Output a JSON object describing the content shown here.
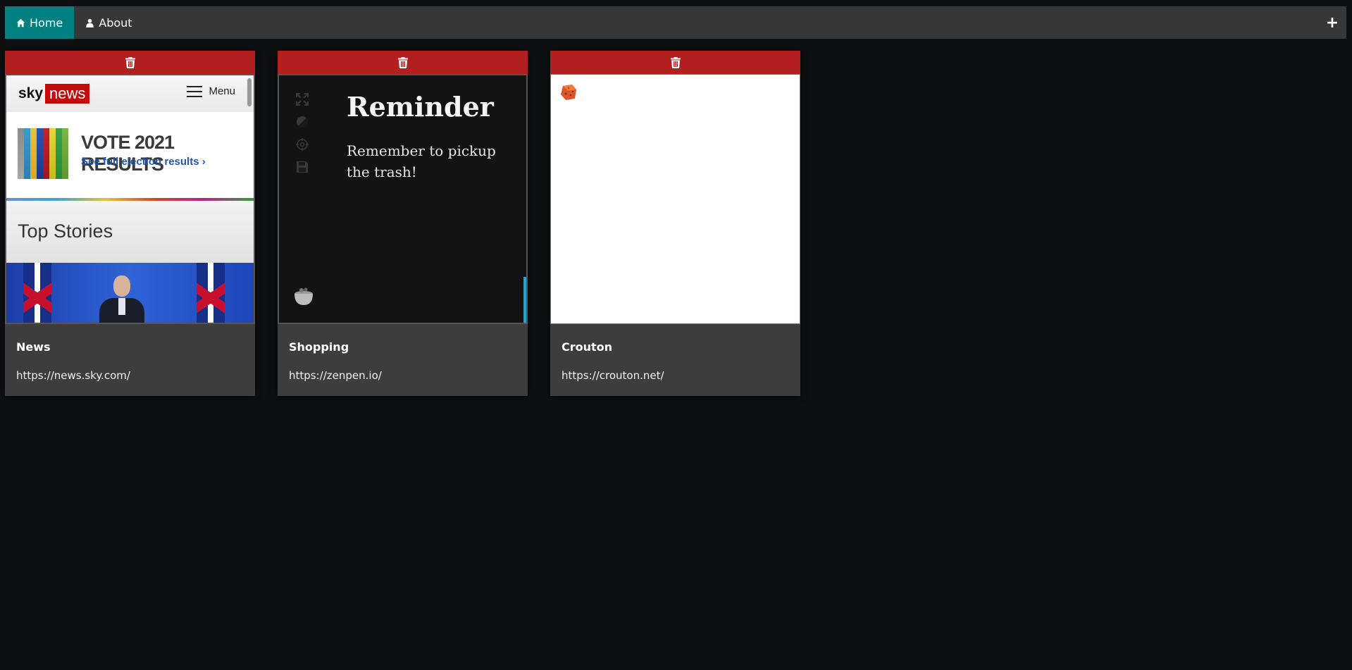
{
  "nav": {
    "home_label": "Home",
    "about_label": "About",
    "add_label": "+"
  },
  "cards": [
    {
      "title": "News",
      "url": "https://news.sky.com/",
      "preview": {
        "logo_sky": "sky",
        "logo_news": "news",
        "menu_label": "Menu",
        "banner_title": "VOTE 2021 RESULTS",
        "banner_link": "See full election results ›",
        "section_title": "Top Stories"
      }
    },
    {
      "title": "Shopping",
      "url": "https://zenpen.io/",
      "preview": {
        "heading": "Reminder",
        "body": "Remember to pickup the trash!"
      }
    },
    {
      "title": "Crouton",
      "url": "https://crouton.net/",
      "preview": {}
    }
  ],
  "colors": {
    "nav_active": "#008080",
    "nav_bg": "#373737",
    "delete_bar": "#b21f1f",
    "card_bg": "#3d3d3d",
    "page_bg": "#0e0f11"
  }
}
